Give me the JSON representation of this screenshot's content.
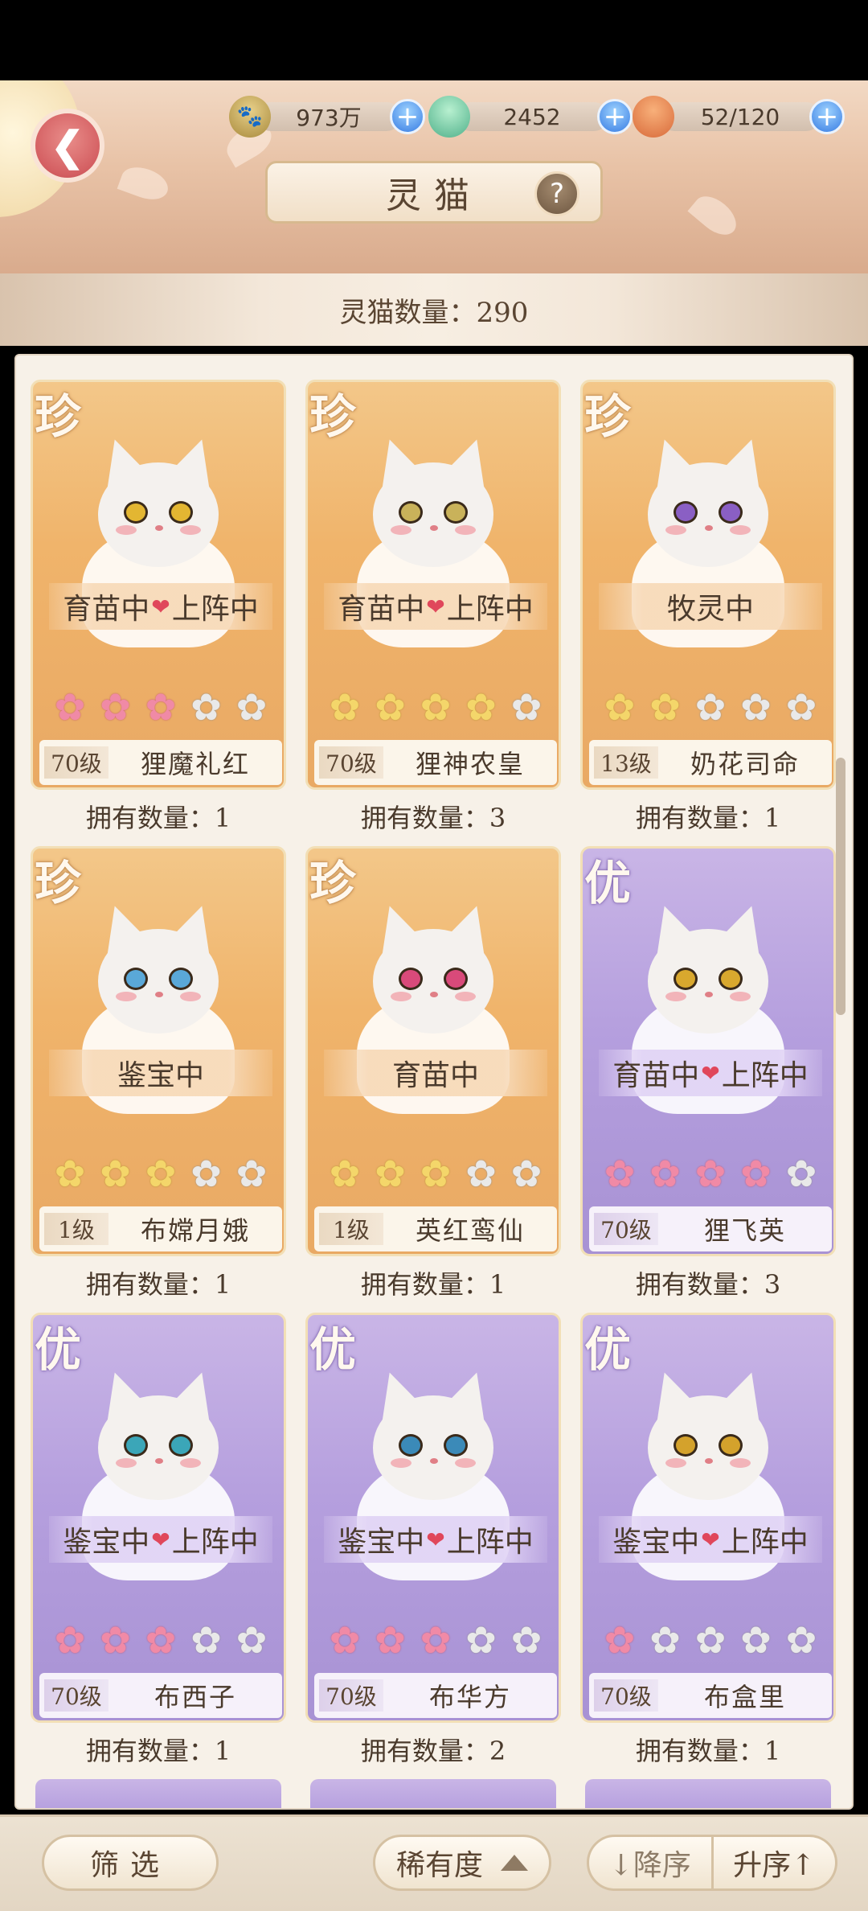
{
  "header": {
    "title": "灵猫",
    "help_glyph": "?",
    "back_glyph": "❮",
    "resources": [
      {
        "icon": "coin-icon",
        "value": "973万"
      },
      {
        "icon": "jade-icon",
        "value": "2452"
      },
      {
        "icon": "food-icon",
        "value": "52/120"
      }
    ],
    "plus_glyph": "+"
  },
  "count_label": "灵猫数量：290",
  "cards": [
    {
      "grade": "珍",
      "tier": "zhen",
      "status": "育苗中",
      "status2": "上阵中",
      "stars": [
        "pink",
        "pink",
        "pink",
        "grey",
        "grey"
      ],
      "level": "70级",
      "name": "狸魔礼红",
      "owned": "拥有数量：1",
      "eye": "#e3b632"
    },
    {
      "grade": "珍",
      "tier": "zhen",
      "status": "育苗中",
      "status2": "上阵中",
      "stars": [
        "gold",
        "gold",
        "gold",
        "gold",
        "grey"
      ],
      "level": "70级",
      "name": "狸神农皇",
      "owned": "拥有数量：3",
      "eye": "#c9b25a"
    },
    {
      "grade": "珍",
      "tier": "zhen",
      "status": "牧灵中",
      "status2": "",
      "stars": [
        "gold",
        "gold",
        "grey",
        "grey",
        "grey"
      ],
      "level": "13级",
      "name": "奶花司命",
      "owned": "拥有数量：1",
      "eye": "#8a5fc4"
    },
    {
      "grade": "珍",
      "tier": "zhen",
      "status": "鉴宝中",
      "status2": "",
      "stars": [
        "gold",
        "gold",
        "gold",
        "grey",
        "grey"
      ],
      "level": "1级",
      "name": "布嫦月娥",
      "owned": "拥有数量：1",
      "eye": "#5aa8d8"
    },
    {
      "grade": "珍",
      "tier": "zhen",
      "status": "育苗中",
      "status2": "",
      "stars": [
        "gold",
        "gold",
        "gold",
        "grey",
        "grey"
      ],
      "level": "1级",
      "name": "英红鸾仙",
      "owned": "拥有数量：1",
      "eye": "#d94a7a"
    },
    {
      "grade": "优",
      "tier": "you",
      "status": "育苗中",
      "status2": "上阵中",
      "stars": [
        "pink",
        "pink",
        "pink",
        "pink",
        "grey"
      ],
      "level": "70级",
      "name": "狸飞英",
      "owned": "拥有数量：3",
      "eye": "#d9a82e"
    },
    {
      "grade": "优",
      "tier": "you",
      "status": "鉴宝中",
      "status2": "上阵中",
      "stars": [
        "pink",
        "pink",
        "pink",
        "grey",
        "grey"
      ],
      "level": "70级",
      "name": "布西子",
      "owned": "拥有数量：1",
      "eye": "#3ba6b8"
    },
    {
      "grade": "优",
      "tier": "you",
      "status": "鉴宝中",
      "status2": "上阵中",
      "stars": [
        "pink",
        "pink",
        "pink",
        "grey",
        "grey"
      ],
      "level": "70级",
      "name": "布华方",
      "owned": "拥有数量：2",
      "eye": "#3b8ab8"
    },
    {
      "grade": "优",
      "tier": "you",
      "status": "鉴宝中",
      "status2": "上阵中",
      "stars": [
        "pink",
        "grey",
        "grey",
        "grey",
        "grey"
      ],
      "level": "70级",
      "name": "布盒里",
      "owned": "拥有数量：1",
      "eye": "#d4a22c"
    }
  ],
  "heart_glyph": "❤",
  "star_glyph": "✿",
  "bottom": {
    "filter_label": "筛选",
    "rarity_label": "稀有度",
    "desc_label": "↓降序",
    "asc_label": "升序↑"
  }
}
